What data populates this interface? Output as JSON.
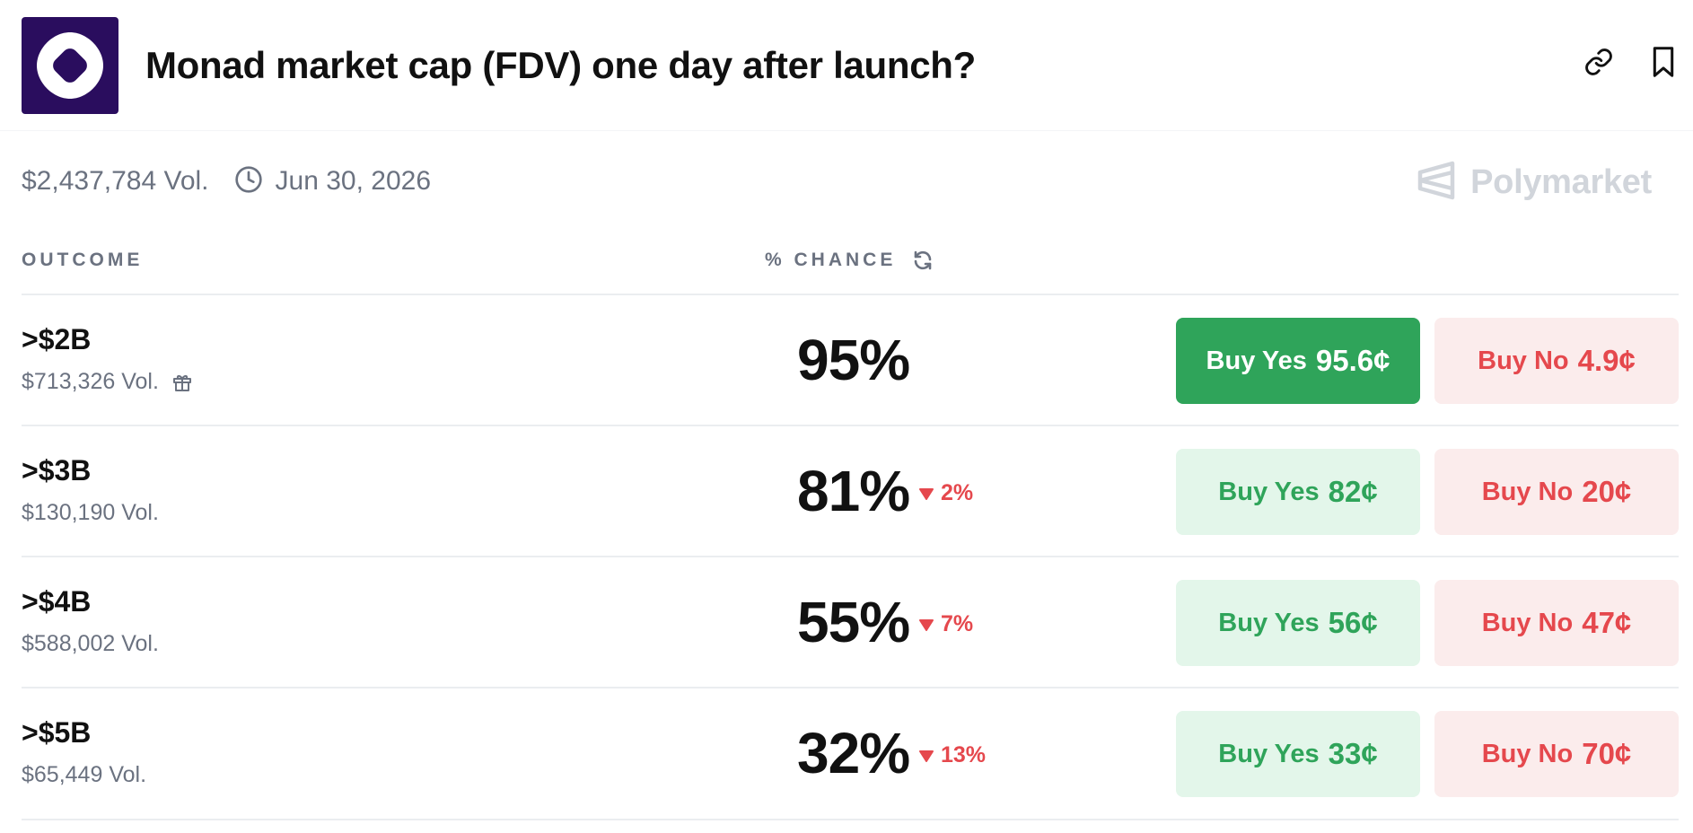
{
  "market": {
    "title": "Monad market cap (FDV) one day after launch?",
    "volume": "$2,437,784 Vol.",
    "end_date": "Jun 30, 2026",
    "brand": "Polymarket"
  },
  "columns": {
    "outcome": "OUTCOME",
    "chance": "% CHANCE"
  },
  "colors": {
    "logo_bg": "#2a0d5e",
    "yes_green": "#2fa45a",
    "yes_bg": "#e3f6ea",
    "no_red": "#e5484d",
    "no_bg": "#fbecec"
  },
  "outcomes": [
    {
      "label": ">$2B",
      "volume": "$713,326 Vol.",
      "chance": "95%",
      "delta": "",
      "yes_label": "Buy Yes",
      "yes_price": "95.6¢",
      "no_label": "Buy No",
      "no_price": "4.9¢",
      "has_gift_icon": true,
      "yes_selected": true
    },
    {
      "label": ">$3B",
      "volume": "$130,190 Vol.",
      "chance": "81%",
      "delta": "2%",
      "yes_label": "Buy Yes",
      "yes_price": "82¢",
      "no_label": "Buy No",
      "no_price": "20¢"
    },
    {
      "label": ">$4B",
      "volume": "$588,002 Vol.",
      "chance": "55%",
      "delta": "7%",
      "yes_label": "Buy Yes",
      "yes_price": "56¢",
      "no_label": "Buy No",
      "no_price": "47¢"
    },
    {
      "label": ">$5B",
      "volume": "$65,449 Vol.",
      "chance": "32%",
      "delta": "13%",
      "yes_label": "Buy Yes",
      "yes_price": "33¢",
      "no_label": "Buy No",
      "no_price": "70¢"
    }
  ]
}
